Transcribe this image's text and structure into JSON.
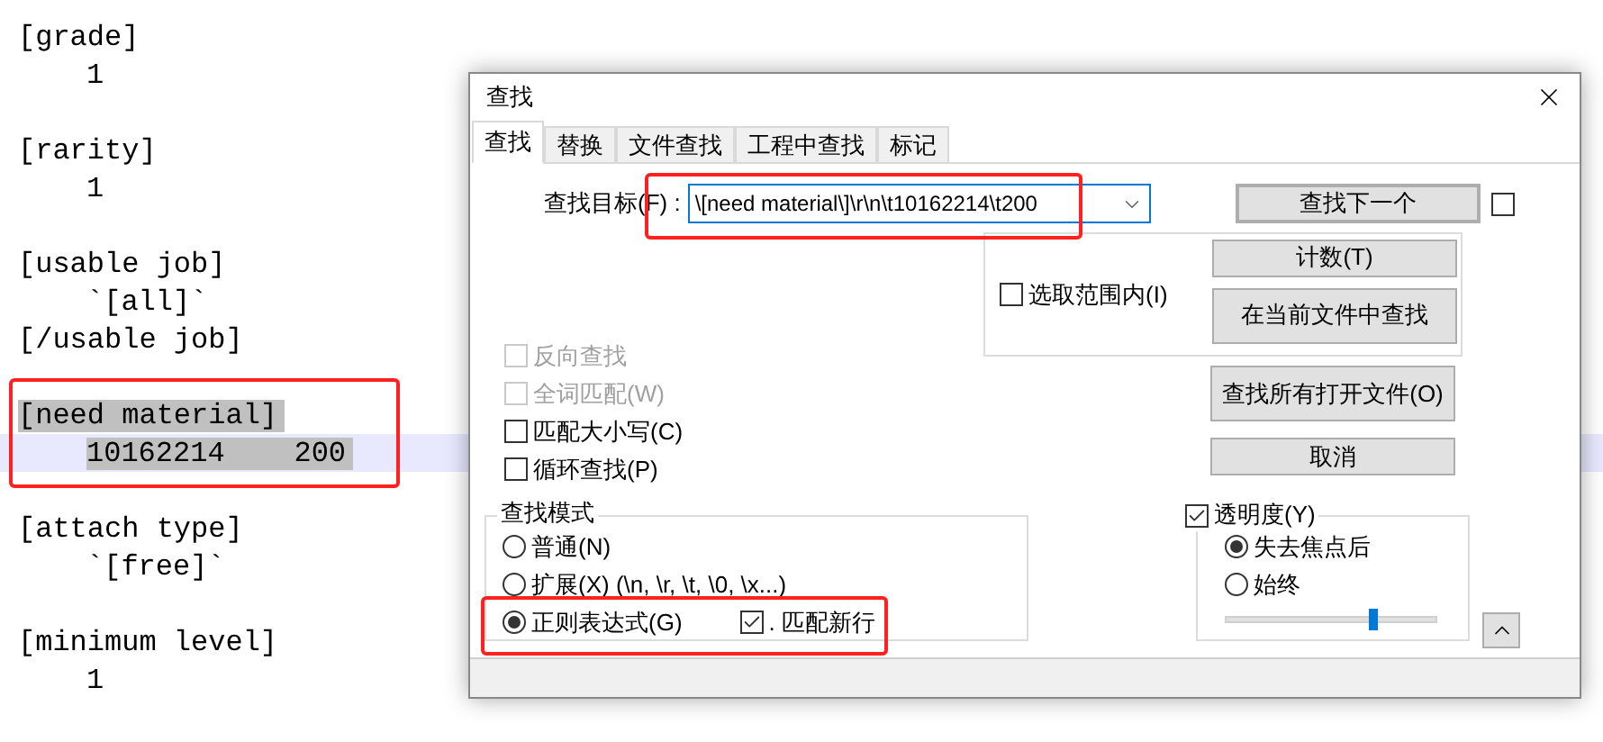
{
  "editor": {
    "lines": [
      {
        "kind": "tag",
        "text": "[grade]",
        "selected": false,
        "current": false
      },
      {
        "kind": "value",
        "text": "1",
        "selected": false,
        "current": false
      },
      {
        "kind": "blank",
        "current": false
      },
      {
        "kind": "tag",
        "text": "[rarity]",
        "selected": false,
        "current": false
      },
      {
        "kind": "value",
        "text": "1",
        "selected": false,
        "current": false
      },
      {
        "kind": "blank",
        "current": false
      },
      {
        "kind": "tag",
        "text": "[usable job]",
        "selected": false,
        "current": false
      },
      {
        "kind": "value",
        "text": "`[all]`",
        "selected": false,
        "current": false
      },
      {
        "kind": "tag",
        "text": "[/usable job]",
        "selected": false,
        "current": false
      },
      {
        "kind": "blank",
        "current": false
      },
      {
        "kind": "tag",
        "text": "[need material]",
        "selected": true,
        "current": false
      },
      {
        "kind": "value",
        "text": "10162214    200",
        "selected": true,
        "current": true
      },
      {
        "kind": "blank",
        "current": false
      },
      {
        "kind": "tag",
        "text": "[attach type]",
        "selected": false,
        "current": false
      },
      {
        "kind": "value",
        "text": "`[free]`",
        "selected": false,
        "current": false
      },
      {
        "kind": "blank",
        "current": false
      },
      {
        "kind": "tag",
        "text": "[minimum level]",
        "selected": false,
        "current": false
      },
      {
        "kind": "value",
        "text": "1",
        "selected": false,
        "current": false
      }
    ]
  },
  "dialog": {
    "title": "查找",
    "tabs": [
      {
        "label": "查找",
        "selected": true
      },
      {
        "label": "替换",
        "selected": false
      },
      {
        "label": "文件查找",
        "selected": false
      },
      {
        "label": "工程中查找",
        "selected": false
      },
      {
        "label": "标记",
        "selected": false
      }
    ],
    "find_label": "查找目标(F) :",
    "find_value": "\\[need material\\]\\r\\n\\t10162214\\t200",
    "find_next": {
      "label": "查找下一个",
      "default": true
    },
    "stay_open": {
      "checked": false
    },
    "in_selection": {
      "label": "选取范围内(I)",
      "checked": false
    },
    "count_button": "计数(T)",
    "find_in_current_button": "在当前文件中查找",
    "find_all_open_button": "查找所有打开文件(O)",
    "cancel_button": "取消",
    "options": [
      {
        "label": "反向查找",
        "checked": false,
        "disabled": true
      },
      {
        "label": "全词匹配(W)",
        "checked": false,
        "disabled": true
      },
      {
        "label": "匹配大小写(C)",
        "checked": false,
        "disabled": false
      },
      {
        "label": "循环查找(P)",
        "checked": false,
        "disabled": false
      }
    ],
    "mode": {
      "title": "查找模式",
      "options": [
        {
          "label": "普通(N)",
          "selected": false
        },
        {
          "label": "扩展(X) (\\n, \\r, \\t, \\0, \\x...)",
          "selected": false
        },
        {
          "label": "正则表达式(G)",
          "selected": true
        }
      ],
      "dot_newline": {
        "label": ". 匹配新行",
        "checked": true
      }
    },
    "transparency": {
      "label": "透明度(Y)",
      "checked": true,
      "options": [
        {
          "label": "失去焦点后",
          "selected": true
        },
        {
          "label": "始终",
          "selected": false
        }
      ],
      "level": 0.71
    }
  }
}
